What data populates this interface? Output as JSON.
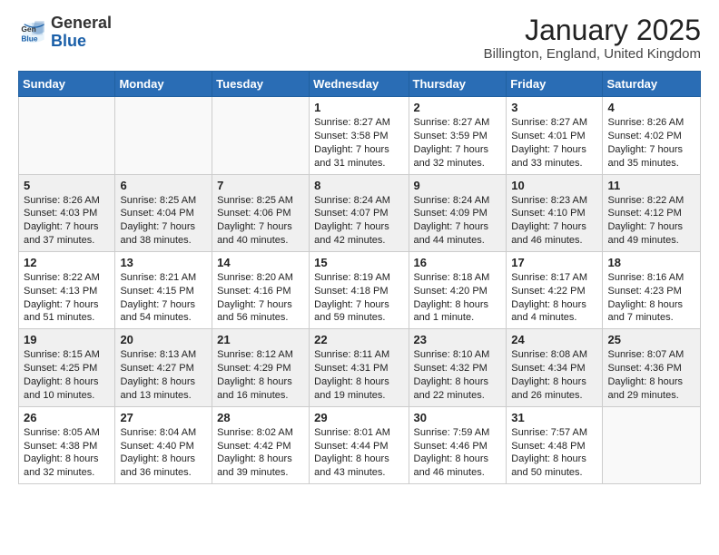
{
  "header": {
    "logo_general": "General",
    "logo_blue": "Blue",
    "month_title": "January 2025",
    "location": "Billington, England, United Kingdom"
  },
  "weekdays": [
    "Sunday",
    "Monday",
    "Tuesday",
    "Wednesday",
    "Thursday",
    "Friday",
    "Saturday"
  ],
  "weeks": [
    [
      {
        "day": "",
        "info": ""
      },
      {
        "day": "",
        "info": ""
      },
      {
        "day": "",
        "info": ""
      },
      {
        "day": "1",
        "info": "Sunrise: 8:27 AM\nSunset: 3:58 PM\nDaylight: 7 hours\nand 31 minutes."
      },
      {
        "day": "2",
        "info": "Sunrise: 8:27 AM\nSunset: 3:59 PM\nDaylight: 7 hours\nand 32 minutes."
      },
      {
        "day": "3",
        "info": "Sunrise: 8:27 AM\nSunset: 4:01 PM\nDaylight: 7 hours\nand 33 minutes."
      },
      {
        "day": "4",
        "info": "Sunrise: 8:26 AM\nSunset: 4:02 PM\nDaylight: 7 hours\nand 35 minutes."
      }
    ],
    [
      {
        "day": "5",
        "info": "Sunrise: 8:26 AM\nSunset: 4:03 PM\nDaylight: 7 hours\nand 37 minutes."
      },
      {
        "day": "6",
        "info": "Sunrise: 8:25 AM\nSunset: 4:04 PM\nDaylight: 7 hours\nand 38 minutes."
      },
      {
        "day": "7",
        "info": "Sunrise: 8:25 AM\nSunset: 4:06 PM\nDaylight: 7 hours\nand 40 minutes."
      },
      {
        "day": "8",
        "info": "Sunrise: 8:24 AM\nSunset: 4:07 PM\nDaylight: 7 hours\nand 42 minutes."
      },
      {
        "day": "9",
        "info": "Sunrise: 8:24 AM\nSunset: 4:09 PM\nDaylight: 7 hours\nand 44 minutes."
      },
      {
        "day": "10",
        "info": "Sunrise: 8:23 AM\nSunset: 4:10 PM\nDaylight: 7 hours\nand 46 minutes."
      },
      {
        "day": "11",
        "info": "Sunrise: 8:22 AM\nSunset: 4:12 PM\nDaylight: 7 hours\nand 49 minutes."
      }
    ],
    [
      {
        "day": "12",
        "info": "Sunrise: 8:22 AM\nSunset: 4:13 PM\nDaylight: 7 hours\nand 51 minutes."
      },
      {
        "day": "13",
        "info": "Sunrise: 8:21 AM\nSunset: 4:15 PM\nDaylight: 7 hours\nand 54 minutes."
      },
      {
        "day": "14",
        "info": "Sunrise: 8:20 AM\nSunset: 4:16 PM\nDaylight: 7 hours\nand 56 minutes."
      },
      {
        "day": "15",
        "info": "Sunrise: 8:19 AM\nSunset: 4:18 PM\nDaylight: 7 hours\nand 59 minutes."
      },
      {
        "day": "16",
        "info": "Sunrise: 8:18 AM\nSunset: 4:20 PM\nDaylight: 8 hours\nand 1 minute."
      },
      {
        "day": "17",
        "info": "Sunrise: 8:17 AM\nSunset: 4:22 PM\nDaylight: 8 hours\nand 4 minutes."
      },
      {
        "day": "18",
        "info": "Sunrise: 8:16 AM\nSunset: 4:23 PM\nDaylight: 8 hours\nand 7 minutes."
      }
    ],
    [
      {
        "day": "19",
        "info": "Sunrise: 8:15 AM\nSunset: 4:25 PM\nDaylight: 8 hours\nand 10 minutes."
      },
      {
        "day": "20",
        "info": "Sunrise: 8:13 AM\nSunset: 4:27 PM\nDaylight: 8 hours\nand 13 minutes."
      },
      {
        "day": "21",
        "info": "Sunrise: 8:12 AM\nSunset: 4:29 PM\nDaylight: 8 hours\nand 16 minutes."
      },
      {
        "day": "22",
        "info": "Sunrise: 8:11 AM\nSunset: 4:31 PM\nDaylight: 8 hours\nand 19 minutes."
      },
      {
        "day": "23",
        "info": "Sunrise: 8:10 AM\nSunset: 4:32 PM\nDaylight: 8 hours\nand 22 minutes."
      },
      {
        "day": "24",
        "info": "Sunrise: 8:08 AM\nSunset: 4:34 PM\nDaylight: 8 hours\nand 26 minutes."
      },
      {
        "day": "25",
        "info": "Sunrise: 8:07 AM\nSunset: 4:36 PM\nDaylight: 8 hours\nand 29 minutes."
      }
    ],
    [
      {
        "day": "26",
        "info": "Sunrise: 8:05 AM\nSunset: 4:38 PM\nDaylight: 8 hours\nand 32 minutes."
      },
      {
        "day": "27",
        "info": "Sunrise: 8:04 AM\nSunset: 4:40 PM\nDaylight: 8 hours\nand 36 minutes."
      },
      {
        "day": "28",
        "info": "Sunrise: 8:02 AM\nSunset: 4:42 PM\nDaylight: 8 hours\nand 39 minutes."
      },
      {
        "day": "29",
        "info": "Sunrise: 8:01 AM\nSunset: 4:44 PM\nDaylight: 8 hours\nand 43 minutes."
      },
      {
        "day": "30",
        "info": "Sunrise: 7:59 AM\nSunset: 4:46 PM\nDaylight: 8 hours\nand 46 minutes."
      },
      {
        "day": "31",
        "info": "Sunrise: 7:57 AM\nSunset: 4:48 PM\nDaylight: 8 hours\nand 50 minutes."
      },
      {
        "day": "",
        "info": ""
      }
    ]
  ]
}
